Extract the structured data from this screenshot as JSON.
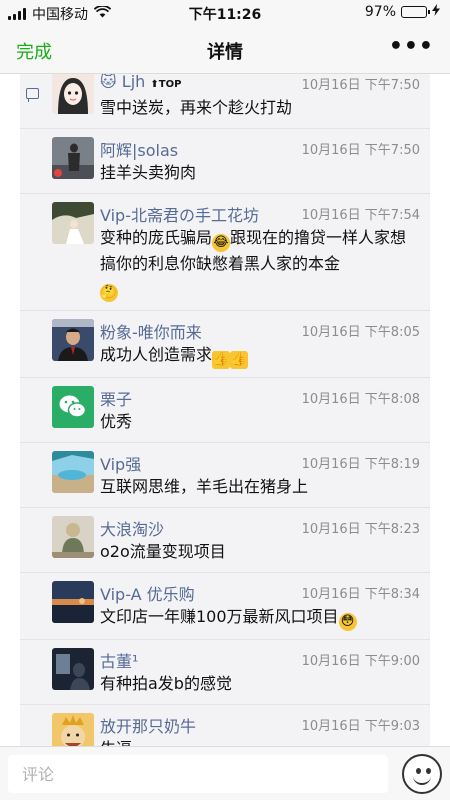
{
  "status_bar": {
    "carrier": "中国移动",
    "time": "下午11:26",
    "battery_text": "97%",
    "battery_level": 0.97
  },
  "nav": {
    "done": "完成",
    "title": "详情",
    "more": "•••"
  },
  "comments": [
    {
      "name": "Ljh",
      "time": "10月16日 下午7:50",
      "text": "雪中送炭，再来个趁火打劫",
      "emoji_tail": "",
      "name_prefix_icon": "cat-face-icon",
      "name_suffix_icon": "top-arrow-icon",
      "avatar": "cartoon-girl",
      "avatar_colors": [
        "#f4e7e1",
        "#2b2b2b"
      ]
    },
    {
      "name": "阿辉|solas",
      "time": "10月16日 下午7:50",
      "text": "挂羊头卖狗肉",
      "emoji_tail": "",
      "avatar": "dark-figure",
      "avatar_colors": [
        "#7a8087",
        "#2c2c2c"
      ]
    },
    {
      "name": "Vip-北斋君の手工花坊",
      "time": "10月16日 下午7:54",
      "text": "变种的庞氏骗局",
      "text2": "跟现在的撸贷一样人家想搞你的利息你缺憋着黑人家的本金",
      "emoji_tail": "",
      "avatar": "outdoor-bride",
      "avatar_colors": [
        "#dcd9c9",
        "#3e4a34"
      ]
    },
    {
      "name": "粉象-唯你而来",
      "time": "10月16日 下午8:05",
      "text": "成功人创造需求",
      "emoji_tail": "",
      "avatar": "man-portrait",
      "avatar_colors": [
        "#3a4a6a",
        "#1a1a1a"
      ]
    },
    {
      "name": "栗子",
      "time": "10月16日 下午8:08",
      "text": "优秀",
      "emoji_tail": "",
      "avatar": "wechat-logo",
      "avatar_colors": [
        "#2aae67",
        "#ffffff"
      ]
    },
    {
      "name": "Vip强",
      "time": "10月16日 下午8:19",
      "text": "互联网思维，羊毛出在猪身上",
      "emoji_tail": "",
      "avatar": "pool-scene",
      "avatar_colors": [
        "#8ed0e8",
        "#c8b088"
      ]
    },
    {
      "name": "大浪淘沙",
      "time": "10月16日 下午8:23",
      "text": "o2o流量变现项目",
      "emoji_tail": "",
      "avatar": "statue",
      "avatar_colors": [
        "#d8d3c6",
        "#6d7a5a"
      ]
    },
    {
      "name": "Vip-A  优乐购",
      "time": "10月16日 下午8:34",
      "text": "文印店一年赚100万最新风口项目",
      "emoji_tail": "",
      "avatar": "sunset-lake",
      "avatar_colors": [
        "#2a3a5a",
        "#d88a4a"
      ]
    },
    {
      "name": "古董¹",
      "time": "10月16日 下午9:00",
      "text": "有种拍a发b的感觉",
      "emoji_tail": "",
      "avatar": "dark-room",
      "avatar_colors": [
        "#1c2433",
        "#6c7f96"
      ]
    },
    {
      "name": "放开那只奶牛",
      "time": "10月16日 下午9:03",
      "text": "牛逼",
      "emoji_tail": "",
      "avatar": "cartoon-king",
      "avatar_colors": [
        "#f1c76a",
        "#a0462a"
      ]
    }
  ],
  "input": {
    "placeholder": "评论"
  },
  "emoji_button_icon": "smiley-face-icon"
}
